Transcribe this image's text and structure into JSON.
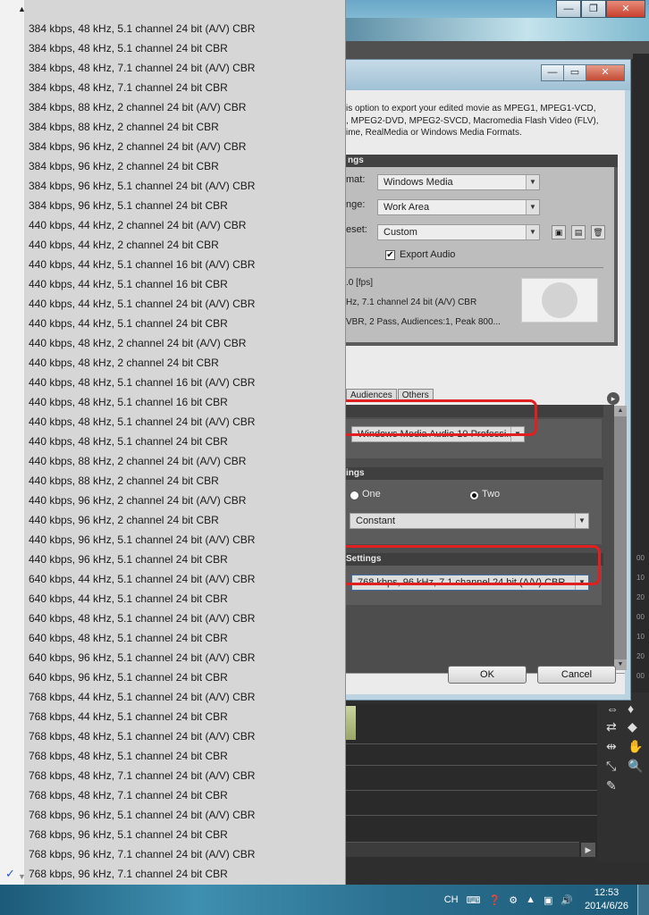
{
  "dialog": {
    "description": "is option to export your edited movie as MPEG1, MPEG1-VCD,\n, MPEG2-DVD, MPEG2-SVCD, Macromedia Flash Video (FLV),\nime, RealMedia or Windows Media Formats.",
    "settings_header": "ngs",
    "format_label": "mat:",
    "format_value": "Windows Media",
    "range_label": "nge:",
    "range_value": "Work Area",
    "preset_label": "eset:",
    "preset_value": "Custom",
    "export_audio_label": "Export Audio",
    "export_audio_checked": true,
    "summary_fps": ".0 [fps]",
    "summary_audio": "Hz, 7.1 channel 24 bit (A/V) CBR",
    "summary_mode": "VBR, 2 Pass, Audiences:1, Peak 800...",
    "tabs": [
      "Audiences",
      "Others"
    ],
    "codec_value": "Windows Media Audio 10 Professi...",
    "encoding_header": "ings",
    "passes_one": "One",
    "passes_two": "Two",
    "passes_selected": "Two",
    "bitrate_mode": "Constant",
    "settings_header2": "Settings",
    "audio_format_value": "768 kbps, 96 kHz, 7.1 channel 24 bit (A/V) CBR",
    "ok_label": "OK",
    "cancel_label": "Cancel"
  },
  "popup": {
    "selected_index": 43,
    "items": [
      "384 kbps, 48 kHz, 5.1 channel 24 bit (A/V) CBR",
      "384 kbps, 48 kHz, 5.1 channel 24 bit CBR",
      "384 kbps, 48 kHz, 7.1 channel 24 bit (A/V) CBR",
      "384 kbps, 48 kHz, 7.1 channel 24 bit CBR",
      "384 kbps, 88 kHz, 2 channel 24 bit (A/V) CBR",
      "384 kbps, 88 kHz, 2 channel 24 bit CBR",
      "384 kbps, 96 kHz, 2 channel 24 bit (A/V) CBR",
      "384 kbps, 96 kHz, 2 channel 24 bit CBR",
      "384 kbps, 96 kHz, 5.1 channel 24 bit (A/V) CBR",
      "384 kbps, 96 kHz, 5.1 channel 24 bit CBR",
      "440 kbps, 44 kHz, 2 channel 24 bit (A/V) CBR",
      "440 kbps, 44 kHz, 2 channel 24 bit CBR",
      "440 kbps, 44 kHz, 5.1 channel 16 bit (A/V) CBR",
      "440 kbps, 44 kHz, 5.1 channel 16 bit CBR",
      "440 kbps, 44 kHz, 5.1 channel 24 bit (A/V) CBR",
      "440 kbps, 44 kHz, 5.1 channel 24 bit CBR",
      "440 kbps, 48 kHz, 2 channel 24 bit (A/V) CBR",
      "440 kbps, 48 kHz, 2 channel 24 bit CBR",
      "440 kbps, 48 kHz, 5.1 channel 16 bit (A/V) CBR",
      "440 kbps, 48 kHz, 5.1 channel 16 bit CBR",
      "440 kbps, 48 kHz, 5.1 channel 24 bit (A/V) CBR",
      "440 kbps, 48 kHz, 5.1 channel 24 bit CBR",
      "440 kbps, 88 kHz, 2 channel 24 bit (A/V) CBR",
      "440 kbps, 88 kHz, 2 channel 24 bit CBR",
      "440 kbps, 96 kHz, 2 channel 24 bit (A/V) CBR",
      "440 kbps, 96 kHz, 2 channel 24 bit CBR",
      "440 kbps, 96 kHz, 5.1 channel 24 bit (A/V) CBR",
      "440 kbps, 96 kHz, 5.1 channel 24 bit CBR",
      "640 kbps, 44 kHz, 5.1 channel 24 bit (A/V) CBR",
      "640 kbps, 44 kHz, 5.1 channel 24 bit CBR",
      "640 kbps, 48 kHz, 5.1 channel 24 bit (A/V) CBR",
      "640 kbps, 48 kHz, 5.1 channel 24 bit CBR",
      "640 kbps, 96 kHz, 5.1 channel 24 bit (A/V) CBR",
      "640 kbps, 96 kHz, 5.1 channel 24 bit CBR",
      "768 kbps, 44 kHz, 5.1 channel 24 bit (A/V) CBR",
      "768 kbps, 44 kHz, 5.1 channel 24 bit CBR",
      "768 kbps, 48 kHz, 5.1 channel 24 bit (A/V) CBR",
      "768 kbps, 48 kHz, 5.1 channel 24 bit CBR",
      "768 kbps, 48 kHz, 7.1 channel 24 bit (A/V) CBR",
      "768 kbps, 48 kHz, 7.1 channel 24 bit CBR",
      "768 kbps, 96 kHz, 5.1 channel 24 bit (A/V) CBR",
      "768 kbps, 96 kHz, 5.1 channel 24 bit CBR",
      "768 kbps, 96 kHz, 7.1 channel 24 bit (A/V) CBR",
      "768 kbps, 96 kHz, 7.1 channel 24 bit CBR"
    ],
    "checked_item": "768 kbps, 96 kHz, 7.1 channel 24 bit (A/V) CBR"
  },
  "timeline_ticks": [
    "00",
    "10",
    "20",
    "00",
    "10",
    "20",
    "00",
    "10",
    "20"
  ],
  "taskbar": {
    "ime": "CH",
    "time": "12:53",
    "date": "2014/6/26"
  },
  "colors": {
    "highlight": "#e02020",
    "check": "#1f56c8"
  }
}
